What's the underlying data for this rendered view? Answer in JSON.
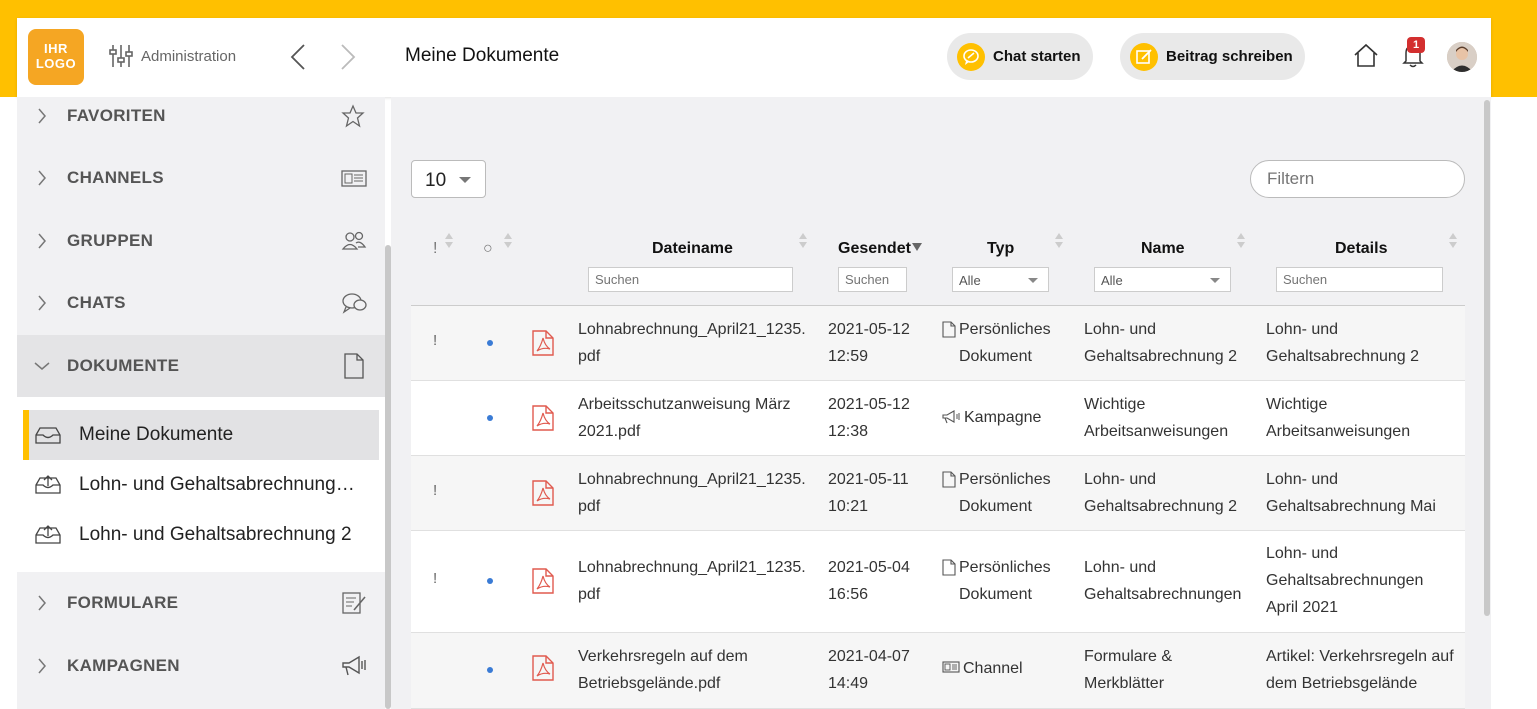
{
  "header": {
    "logo": [
      "IHR",
      "LOGO"
    ],
    "admin_label": "Administration",
    "page_title": "Meine Dokumente",
    "chat_button": "Chat starten",
    "post_button": "Beitrag schreiben",
    "notification_count": "1"
  },
  "sidebar": {
    "items": [
      {
        "label": "FAVORITEN",
        "icon": "star-icon"
      },
      {
        "label": "CHANNELS",
        "icon": "newspaper-icon"
      },
      {
        "label": "GRUPPEN",
        "icon": "group-icon"
      },
      {
        "label": "CHATS",
        "icon": "chat-icon"
      },
      {
        "label": "DOKUMENTE",
        "icon": "document-icon"
      },
      {
        "label": "FORMULARE",
        "icon": "form-icon"
      },
      {
        "label": "KAMPAGNEN",
        "icon": "megaphone-icon"
      }
    ],
    "sub_items": [
      {
        "label": "Meine Dokumente",
        "icon": "inbox-icon"
      },
      {
        "label": "Lohn- und Gehaltsabrechnung…",
        "icon": "inbox-upload-icon"
      },
      {
        "label": "Lohn- und Gehaltsabrechnung 2",
        "icon": "inbox-upload-icon"
      }
    ]
  },
  "table": {
    "page_size": "10",
    "filter_placeholder": "Filtern",
    "headers": {
      "important": "!",
      "read": "○",
      "filename": "Dateiname",
      "sent": "Gesendet",
      "type": "Typ",
      "name": "Name",
      "details": "Details"
    },
    "column_filters": {
      "filename": "Suchen",
      "sent": "Suchen",
      "type": "Alle",
      "name": "Alle",
      "details": "Suchen"
    },
    "rows": [
      {
        "important": "!",
        "unread": true,
        "filename": [
          "Lohnabrechnung_April21_1235.",
          "pdf"
        ],
        "date": "2021-05-12",
        "time": "12:59",
        "type": [
          "Persönliches",
          "Dokument"
        ],
        "type_icon": "document-icon",
        "name": [
          "Lohn- und",
          "Gehaltsabrechnung 2"
        ],
        "details": [
          "Lohn- und",
          "Gehaltsabrechnung 2"
        ]
      },
      {
        "important": "",
        "unread": true,
        "filename": [
          "Arbeitsschutzanweisung März",
          "2021.pdf"
        ],
        "date": "2021-05-12",
        "time": "12:38",
        "type": [
          "Kampagne"
        ],
        "type_icon": "megaphone-icon",
        "name": [
          "Wichtige",
          "Arbeitsanweisungen"
        ],
        "details": [
          "Wichtige",
          "Arbeitsanweisungen"
        ]
      },
      {
        "important": "!",
        "unread": false,
        "filename": [
          "Lohnabrechnung_April21_1235.",
          "pdf"
        ],
        "date": "2021-05-11",
        "time": "10:21",
        "type": [
          "Persönliches",
          "Dokument"
        ],
        "type_icon": "document-icon",
        "name": [
          "Lohn- und",
          "Gehaltsabrechnung 2"
        ],
        "details": [
          "Lohn- und",
          "Gehaltsabrechnung Mai"
        ]
      },
      {
        "important": "!",
        "unread": true,
        "filename": [
          "Lohnabrechnung_April21_1235.",
          "pdf"
        ],
        "date": "2021-05-04",
        "time": "16:56",
        "type": [
          "Persönliches",
          "Dokument"
        ],
        "type_icon": "document-icon",
        "name": [
          "Lohn- und",
          "Gehaltsabrechnungen"
        ],
        "details": [
          "Lohn- und",
          "Gehaltsabrechnungen",
          "April 2021"
        ]
      },
      {
        "important": "",
        "unread": true,
        "filename": [
          "Verkehrsregeln auf dem",
          "Betriebsgelände.pdf"
        ],
        "date": "2021-04-07",
        "time": "14:49",
        "type": [
          "Channel"
        ],
        "type_icon": "newspaper-icon",
        "name": [
          "Formulare &",
          "Merkblätter"
        ],
        "details": [
          "Artikel: Verkehrsregeln auf",
          "dem Betriebsgelände"
        ]
      }
    ]
  },
  "colors": {
    "brand_yellow": "#FFC000",
    "logo_orange": "#F5A623",
    "pdf_red": "#e05a4f",
    "unread_dot": "#3a7bd5",
    "badge_red": "#d32f2f"
  }
}
